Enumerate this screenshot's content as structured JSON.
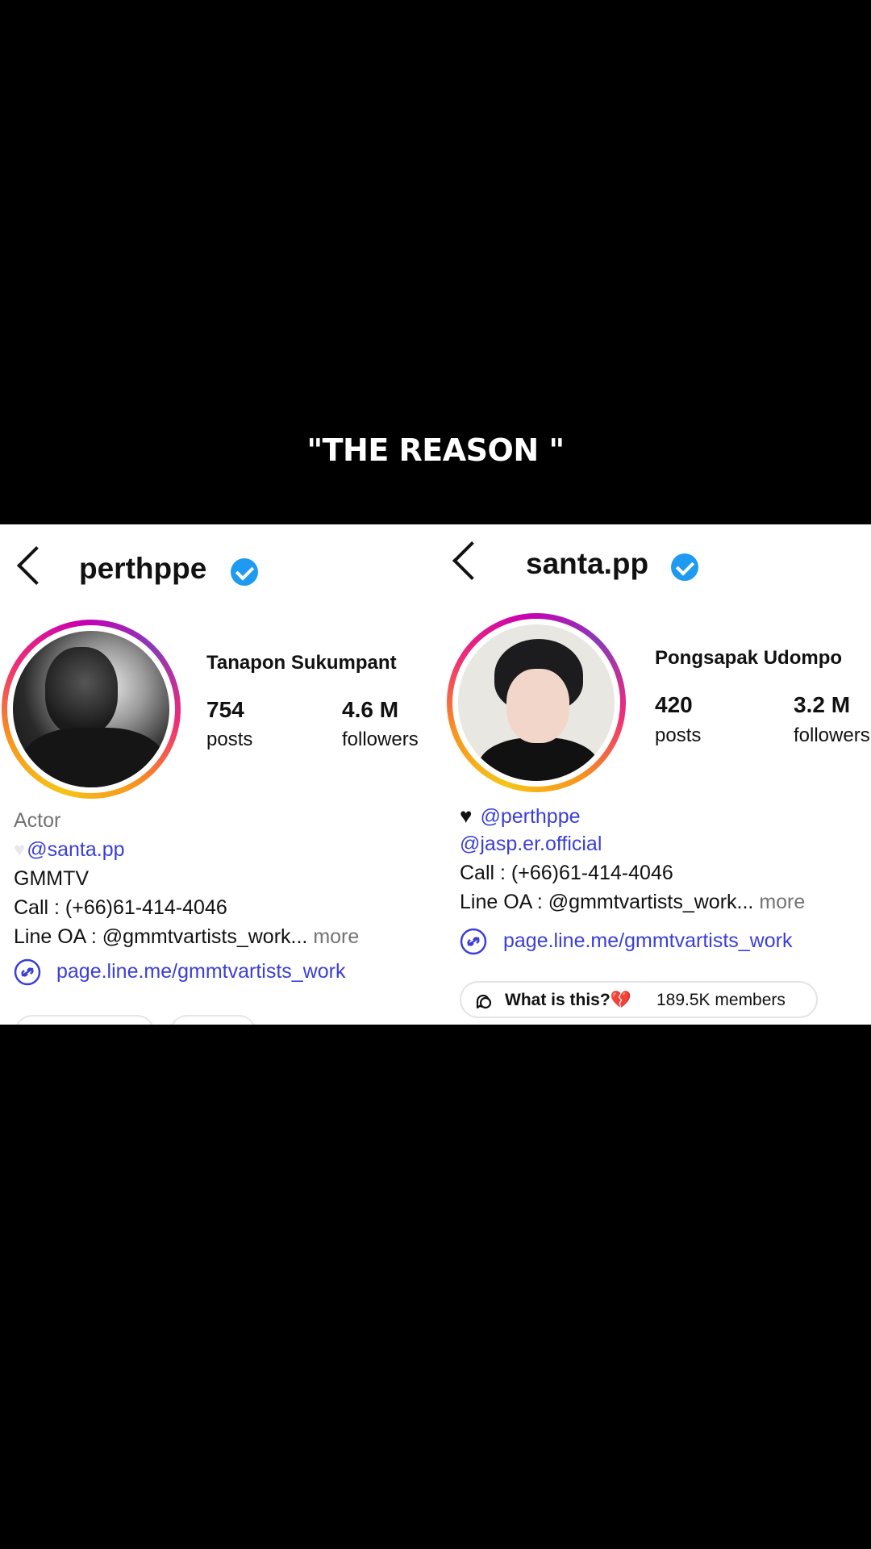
{
  "caption": "\"THE REASON \"",
  "left": {
    "username": "perthppe",
    "full_name": "Tanapon Sukumpant",
    "posts_count": "754",
    "posts_label": "posts",
    "followers_count": "4.6 M",
    "followers_label": "followers",
    "bio": {
      "line1": "Actor",
      "mention": "@santa.pp",
      "line3": "GMMTV",
      "line4": "Call : (+66)61-414-4046",
      "line5": "Line OA : @gmmtvartists_work...",
      "more": "more"
    },
    "link": "page.line.me/gmmtvartists_work"
  },
  "right": {
    "username": "santa.pp",
    "full_name": "Pongsapak Udompo",
    "posts_count": "420",
    "posts_label": "posts",
    "followers_count": "3.2 M",
    "followers_label": "followers",
    "bio": {
      "mention1": "@perthppe",
      "mention2": "@jasp.er.official",
      "line3": "Call : (+66)61-414-4046",
      "line4": "Line OA : @gmmtvartists_work...",
      "more": "more"
    },
    "link": "page.line.me/gmmtvartists_work",
    "channel": {
      "title": "What is this?",
      "members": "189.5K members"
    }
  },
  "colors": {
    "link": "#3b3fd6",
    "verified": "#1e9bf0",
    "muted": "#737373"
  },
  "icons": [
    "back-icon",
    "verified-badge-icon",
    "link-icon",
    "channel-icon",
    "white-heart-icon",
    "black-heart-icon",
    "broken-heart-icon"
  ]
}
